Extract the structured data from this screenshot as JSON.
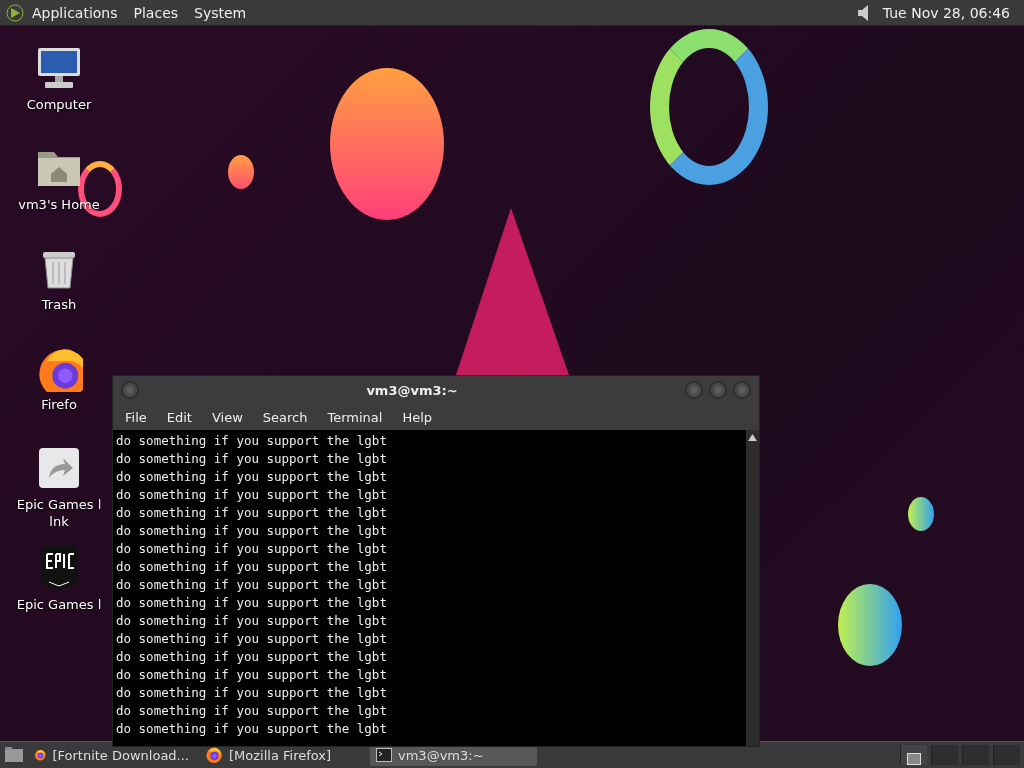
{
  "top_panel": {
    "menus": [
      "Applications",
      "Places",
      "System"
    ],
    "clock": "Tue Nov 28, 06:46"
  },
  "desktop_icons": [
    {
      "kind": "computer",
      "label": "Computer"
    },
    {
      "kind": "folder",
      "label": "vm3's Home"
    },
    {
      "kind": "trash",
      "label": "Trash"
    },
    {
      "kind": "firefox",
      "label": "Firefo"
    },
    {
      "kind": "link",
      "label": "Epic Games l\nlnk"
    },
    {
      "kind": "epic",
      "label": "Epic Games l"
    }
  ],
  "terminal": {
    "title": "vm3@vm3:~",
    "menus": [
      "File",
      "Edit",
      "View",
      "Search",
      "Terminal",
      "Help"
    ],
    "lines": [
      "do something if you support the lgbt",
      "do something if you support the lgbt",
      "do something if you support the lgbt",
      "do something if you support the lgbt",
      "do something if you support the lgbt",
      "do something if you support the lgbt",
      "do something if you support the lgbt",
      "do something if you support the lgbt",
      "do something if you support the lgbt",
      "do something if you support the lgbt",
      "do something if you support the lgbt",
      "do something if you support the lgbt",
      "do something if you support the lgbt",
      "do something if you support the lgbt",
      "do something if you support the lgbt",
      "do something if you support the lgbt",
      "do something if you support the lgbt"
    ]
  },
  "taskbar": {
    "tasks": [
      {
        "kind": "firefox",
        "label": "[Fortnite Download...",
        "selected": false
      },
      {
        "kind": "firefox",
        "label": "[Mozilla Firefox]",
        "selected": false
      },
      {
        "kind": "terminal",
        "label": "vm3@vm3:~",
        "selected": true
      }
    ],
    "workspaces": [
      {
        "selected": true
      },
      {
        "selected": false
      },
      {
        "selected": false
      },
      {
        "selected": false
      }
    ]
  }
}
